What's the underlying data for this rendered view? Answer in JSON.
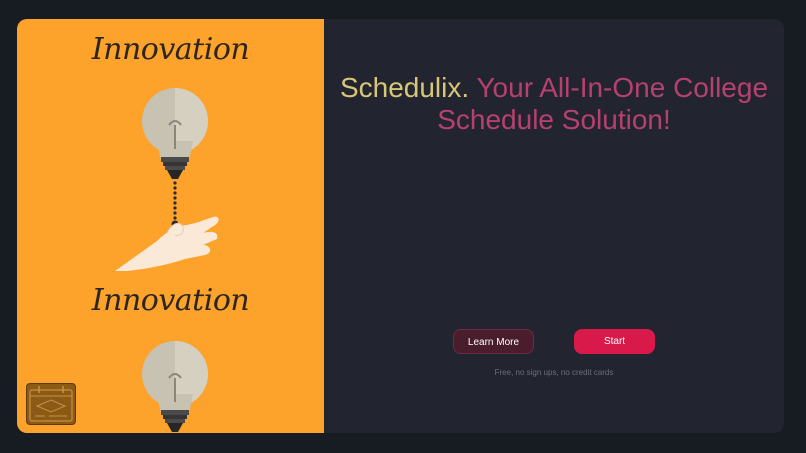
{
  "hero": {
    "illustration_text_top": "Innovation",
    "illustration_text_bottom": "Innovation",
    "illustration_icon": "light-bulb-pull-chain-icon",
    "logo_icon": "calendar-icon"
  },
  "headline": {
    "brand": "Schedulix.",
    "tagline": "Your All-In-One College Schedule Solution!"
  },
  "actions": {
    "learn_more_label": "Learn More",
    "start_label": "Start"
  },
  "note": "Free, no sign ups, no credit cards",
  "colors": {
    "background": "#171b22",
    "card": "#22252f",
    "accent_orange": "#fda22a",
    "brand_gold": "#d8c678",
    "tagline_pink": "#b6406f",
    "start_red": "#d8194a",
    "learn_more_maroon": "#4a1d2d"
  }
}
